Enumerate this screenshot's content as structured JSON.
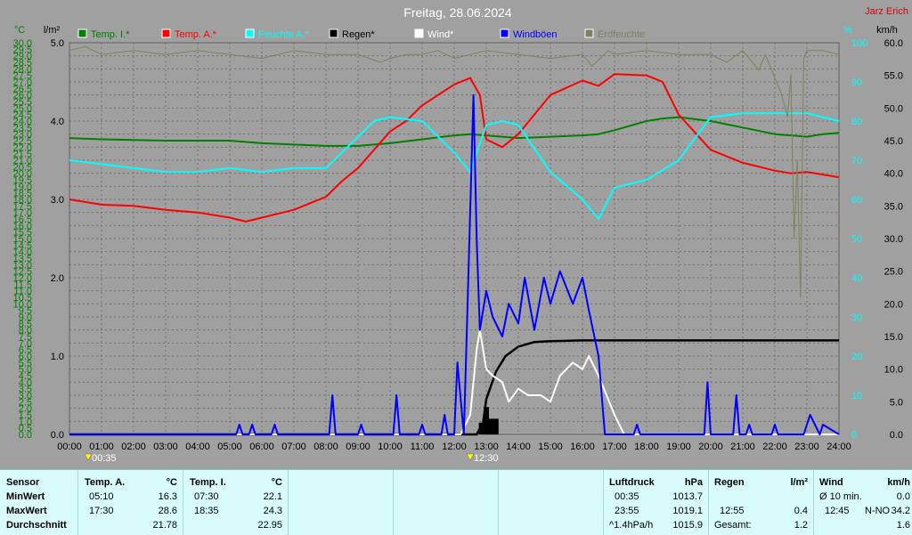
{
  "title": "Freitag, 28.06.2024",
  "brand": "Jarz Erich",
  "units": {
    "left1": "°C",
    "left2": "l/m²",
    "right1": "%",
    "right2": "km/h"
  },
  "legend": [
    {
      "label": "Temp. I.*",
      "color": "#008000"
    },
    {
      "label": "Temp. A.*",
      "color": "#ff0000"
    },
    {
      "label": "Feuchte A.*",
      "color": "#00ffff"
    },
    {
      "label": "Regen*",
      "color": "#000000"
    },
    {
      "label": "Wind*",
      "color": "#ffffff"
    },
    {
      "label": "Windböen",
      "color": "#0000ff"
    },
    {
      "label": "Erdfeuchte",
      "color": "#808060"
    }
  ],
  "markers": [
    {
      "time": "00:35",
      "label": "00:35"
    },
    {
      "time": "12:30",
      "label": "12:30"
    }
  ],
  "chart_data": {
    "type": "line",
    "title": "Freitag, 28.06.2024",
    "x_ticks": [
      "00:00",
      "01:00",
      "02:00",
      "03:00",
      "04:00",
      "05:00",
      "06:00",
      "07:00",
      "08:00",
      "09:00",
      "10:00",
      "11:00",
      "12:00",
      "13:00",
      "14:00",
      "15:00",
      "16:00",
      "17:00",
      "18:00",
      "19:00",
      "20:00",
      "21:00",
      "22:00",
      "23:00",
      "24:00"
    ],
    "axes": {
      "temp_c": {
        "min": 0,
        "max": 30,
        "step": 0.5
      },
      "rain_lm2": {
        "min": 0,
        "max": 5,
        "ticks": [
          "0.0",
          "1.0",
          "2.0",
          "3.0",
          "4.0",
          "5.0"
        ]
      },
      "humidity_pct": {
        "min": 0,
        "max": 100,
        "ticks": [
          "0",
          "10",
          "20",
          "30",
          "40",
          "50",
          "60",
          "70",
          "80",
          "90",
          "100"
        ]
      },
      "wind_kmh": {
        "min": 0,
        "max": 60,
        "ticks": [
          "0.0",
          "5.0",
          "10.0",
          "15.0",
          "20.0",
          "25.0",
          "30.0",
          "35.0",
          "40.0",
          "45.0",
          "50.0",
          "55.0",
          "60.0"
        ]
      }
    },
    "grid": true,
    "series": [
      {
        "name": "Temp. I.*",
        "axis": "temp_c",
        "color": "#008000",
        "x": [
          0,
          1,
          2,
          3,
          4,
          5,
          6,
          7,
          8,
          9,
          10,
          11,
          12,
          12.5,
          13,
          14,
          15,
          16,
          16.5,
          17,
          18,
          18.5,
          19,
          20,
          21,
          22,
          22.5,
          23,
          23.5,
          24
        ],
        "y": [
          22.7,
          22.6,
          22.55,
          22.5,
          22.5,
          22.5,
          22.3,
          22.2,
          22.1,
          22.1,
          22.3,
          22.6,
          22.9,
          23.0,
          22.9,
          22.7,
          22.8,
          22.9,
          23.0,
          23.3,
          24.0,
          24.2,
          24.3,
          24.0,
          23.5,
          23.0,
          22.9,
          22.8,
          23.0,
          23.1
        ]
      },
      {
        "name": "Temp. A.*",
        "axis": "temp_c",
        "color": "#ff0000",
        "x": [
          0,
          1,
          2,
          3,
          4,
          5,
          5.5,
          6,
          7,
          8,
          8.5,
          9,
          10,
          10.5,
          11,
          12,
          12.5,
          12.8,
          13,
          13.5,
          14,
          15,
          16,
          16.5,
          17,
          18,
          18.5,
          19,
          20,
          21,
          22,
          22.5,
          23,
          23.5,
          24
        ],
        "y": [
          18.0,
          17.6,
          17.5,
          17.2,
          17.0,
          16.6,
          16.3,
          16.6,
          17.2,
          18.2,
          19.4,
          20.4,
          23.2,
          24.0,
          25.2,
          26.8,
          27.3,
          26.0,
          22.6,
          22.0,
          23.0,
          26.0,
          27.1,
          26.7,
          27.6,
          27.5,
          27.0,
          24.5,
          21.8,
          20.8,
          20.2,
          20.0,
          20.1,
          19.9,
          19.7
        ]
      },
      {
        "name": "Feuchte A.*",
        "axis": "humidity_pct",
        "color": "#00ffff",
        "x": [
          0,
          1,
          2,
          3,
          4,
          5,
          6,
          7,
          8,
          9,
          9.5,
          10,
          11,
          12,
          12.5,
          13,
          13.5,
          14,
          15,
          16,
          16.5,
          17,
          18,
          19,
          20,
          21,
          22,
          23,
          24
        ],
        "y": [
          70,
          69,
          68,
          67,
          67,
          68,
          67,
          68,
          68,
          76,
          80,
          81,
          80,
          72,
          67,
          79,
          80,
          79,
          67,
          60,
          55,
          63,
          65,
          70,
          81,
          82,
          82,
          82,
          80
        ]
      },
      {
        "name": "Regen*",
        "axis": "rain_lm2",
        "color": "#000000",
        "x": [
          0,
          12.7,
          12.9,
          13.0,
          13.3,
          13.6,
          14,
          14.5,
          15,
          16,
          17,
          18,
          19,
          20,
          21,
          22,
          23,
          24
        ],
        "y": [
          0,
          0,
          0.15,
          0.45,
          0.8,
          1.0,
          1.12,
          1.18,
          1.19,
          1.2,
          1.2,
          1.2,
          1.2,
          1.2,
          1.2,
          1.2,
          1.2,
          1.2
        ]
      },
      {
        "name": "Wind*",
        "axis": "wind_kmh",
        "color": "#ffffff",
        "x": [
          0,
          12.2,
          12.5,
          12.7,
          12.8,
          13.0,
          13.2,
          13.5,
          13.7,
          14,
          14.3,
          14.7,
          15,
          15.3,
          15.7,
          16,
          16.2,
          16.5,
          17,
          17.3,
          24
        ],
        "y": [
          0,
          0,
          3,
          13,
          16,
          10,
          9,
          8,
          5,
          7,
          6,
          6,
          5,
          9,
          11,
          10,
          12,
          9,
          3,
          0,
          0
        ]
      },
      {
        "name": "Windböen",
        "axis": "wind_kmh",
        "color": "#0000ff",
        "x": [
          0,
          5.2,
          5.3,
          5.4,
          5.6,
          5.7,
          5.8,
          6.3,
          6.4,
          6.5,
          8.1,
          8.2,
          8.3,
          9.0,
          9.1,
          9.2,
          10.1,
          10.2,
          10.3,
          10.9,
          11.0,
          11.1,
          11.6,
          11.7,
          11.8,
          12.0,
          12.1,
          12.3,
          12.4,
          12.6,
          12.7,
          12.8,
          13.0,
          13.2,
          13.5,
          13.7,
          14,
          14.2,
          14.5,
          14.8,
          15,
          15.3,
          15.7,
          16,
          16.2,
          16.5,
          16.7,
          17.0,
          17.6,
          17.7,
          17.8,
          19.8,
          19.9,
          20.0,
          20.7,
          20.8,
          20.9,
          21.1,
          21.2,
          21.3,
          21.9,
          22.0,
          22.1,
          22.9,
          23.1,
          23.2,
          23.4,
          23.5,
          24
        ],
        "y": [
          0,
          0,
          1.5,
          0,
          0,
          1.5,
          0,
          0,
          1.5,
          0,
          0,
          6,
          0,
          0,
          1.5,
          0,
          0,
          6,
          0,
          0,
          1.5,
          0,
          0,
          3,
          0,
          0,
          11,
          0,
          17,
          52,
          30,
          16,
          22,
          18,
          15,
          20,
          17,
          24,
          16,
          24,
          20,
          25,
          20,
          24,
          19,
          12,
          0,
          0,
          0,
          1.5,
          0,
          0,
          8,
          0,
          0,
          6,
          0,
          0,
          1.5,
          0,
          0,
          1.5,
          0,
          0,
          3,
          2,
          0,
          1.5,
          0
        ]
      },
      {
        "name": "Erdfeuchte",
        "axis": "humidity_pct",
        "color": "#808060",
        "x": [
          0,
          0.5,
          1,
          2,
          3,
          4,
          5,
          6,
          7,
          8,
          9,
          9.7,
          10,
          10.5,
          11,
          11.5,
          12,
          13,
          14,
          15,
          16,
          16.3,
          16.8,
          17,
          18,
          19,
          20,
          20.5,
          21,
          21.3,
          21.5,
          21.7,
          22,
          22.2,
          22.4,
          22.5,
          22.6,
          22.7,
          22.8,
          22.9,
          23.0,
          23.5,
          24
        ],
        "y": [
          98,
          99,
          97,
          98,
          97,
          98,
          97,
          96,
          98,
          97,
          97,
          95,
          96,
          97,
          97,
          98,
          96,
          98,
          97,
          96,
          97,
          94,
          98,
          97,
          98,
          97,
          97,
          95,
          98,
          95,
          93,
          97,
          91,
          87,
          81,
          92,
          50,
          70,
          35,
          96,
          98,
          98,
          97
        ]
      }
    ]
  },
  "stats": {
    "temp_a": {
      "header": "Temp. A.",
      "unit": "°C"
    },
    "temp_i": {
      "header": "Temp. I.",
      "unit": "°C"
    },
    "labels": {
      "sensor": "Sensor",
      "min": "MinWert",
      "max": "MaxWert",
      "avg": "Durchschnitt"
    },
    "temp_a_rows": {
      "min_time": "05:10",
      "min_val": "16.3",
      "max_time": "17:30",
      "max_val": "28.6",
      "avg_val": "21.78"
    },
    "temp_i_rows": {
      "min_time": "07:30",
      "min_val": "22.1",
      "max_time": "18:35",
      "max_val": "24.3",
      "avg_val": "22.95"
    },
    "pressure": {
      "header": "Luftdruck",
      "unit": "hPa",
      "r1_time": "00:35",
      "r1_val": "1013.7",
      "r2_time": "23:55",
      "r2_val": "1019.1",
      "r3_label": "^1.4hPa/h",
      "r3_val": "1015.9"
    },
    "rain": {
      "header": "Regen",
      "unit": "l/m²",
      "r2_time": "12:55",
      "r2_val": "0.4",
      "r3_label": "Gesamt:",
      "r3_val": "1.2"
    },
    "wind": {
      "header": "Wind",
      "unit": "km/h",
      "r1_label": "Ø 10 min.",
      "r1_val": "0.0",
      "r2_time": "12:45",
      "r2_dir": "N-NO",
      "r2_val": "34.2",
      "r3_val": "1.6"
    }
  }
}
